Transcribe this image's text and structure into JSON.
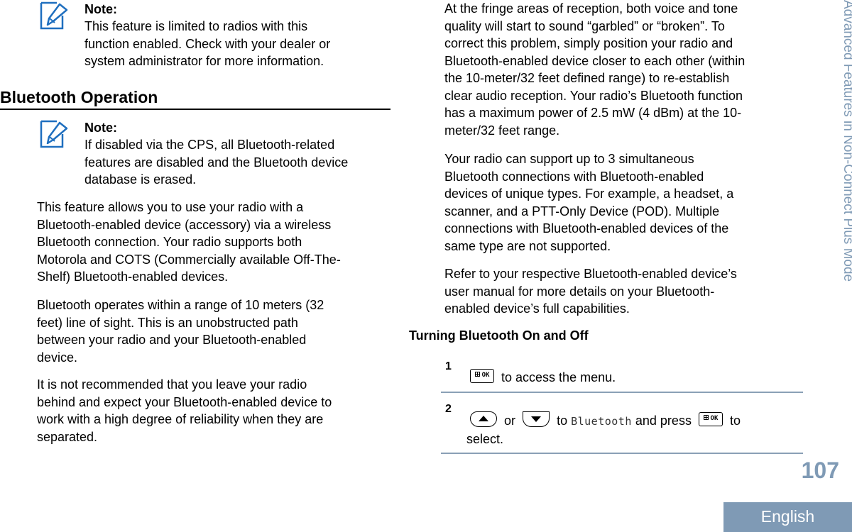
{
  "running_header": "Advanced Features in Non-Connect Plus Mode",
  "page_number": "107",
  "language_tab": "English",
  "colors": {
    "accent": "#7f9ab5",
    "note_icon": "#1f6fbf",
    "rule": "#8aa0b6"
  },
  "left_column": {
    "note1": {
      "icon": "note-pencil-icon",
      "label": "Note:",
      "lines": [
        "This feature is limited to radios with this",
        "function enabled. Check with your dealer or",
        "system administrator for more information."
      ]
    },
    "section_title": "Bluetooth Operation",
    "note2": {
      "icon": "note-pencil-icon",
      "label": "Note:",
      "lines": [
        "If disabled via the CPS, all Bluetooth-related",
        "features are disabled and the Bluetooth device",
        "database is erased."
      ]
    },
    "paragraphs": [
      {
        "lines": [
          "This feature allows you to use your radio with a",
          "Bluetooth-enabled device (accessory) via a wireless",
          "Bluetooth connection. Your radio supports both",
          "Motorola and COTS (Commercially available Off-The-",
          "Shelf) Bluetooth-enabled devices."
        ]
      },
      {
        "lines": [
          "Bluetooth operates within a range of 10 meters (32",
          "feet) line of sight. This is an unobstructed path",
          "between your radio and your Bluetooth-enabled",
          "device."
        ]
      },
      {
        "lines": [
          "It is not recommended that you leave your radio",
          "behind and expect your Bluetooth-enabled device to",
          "work with a high degree of reliability when they are",
          "separated."
        ]
      }
    ]
  },
  "right_column": {
    "paragraphs": [
      {
        "lines": [
          "At the fringe areas of reception, both voice and tone",
          "quality will start to sound “garbled” or “broken”. To",
          "correct this problem, simply position your radio and",
          "Bluetooth-enabled device closer to each other (within",
          "the 10-meter/32 feet defined range) to re-establish",
          "clear audio reception. Your radio’s Bluetooth function",
          "has a maximum power of 2.5 mW (4 dBm) at the 10-",
          "meter/32 feet range."
        ]
      },
      {
        "lines": [
          "Your radio can support up to 3 simultaneous",
          "Bluetooth connections with Bluetooth-enabled",
          "devices of unique types. For example, a headset, a",
          "scanner, and a PTT-Only Device (POD). Multiple",
          "connections with Bluetooth-enabled devices of the",
          "same type are not supported."
        ]
      },
      {
        "lines": [
          "Refer to your respective Bluetooth-enabled device’s",
          "user manual for more details on your Bluetooth-",
          "enabled device’s full capabilities."
        ]
      }
    ],
    "subheading": "Turning Bluetooth On and Off",
    "steps": [
      {
        "number": "1",
        "ok_key_label": "OK",
        "text": "to access the menu."
      },
      {
        "number": "2",
        "or_text": "or",
        "to_text": "to",
        "menu_item": "Bluetooth",
        "and_press_text": "and press",
        "ok_key_label": "OK",
        "tail_text": "to",
        "line2": "select."
      }
    ]
  }
}
